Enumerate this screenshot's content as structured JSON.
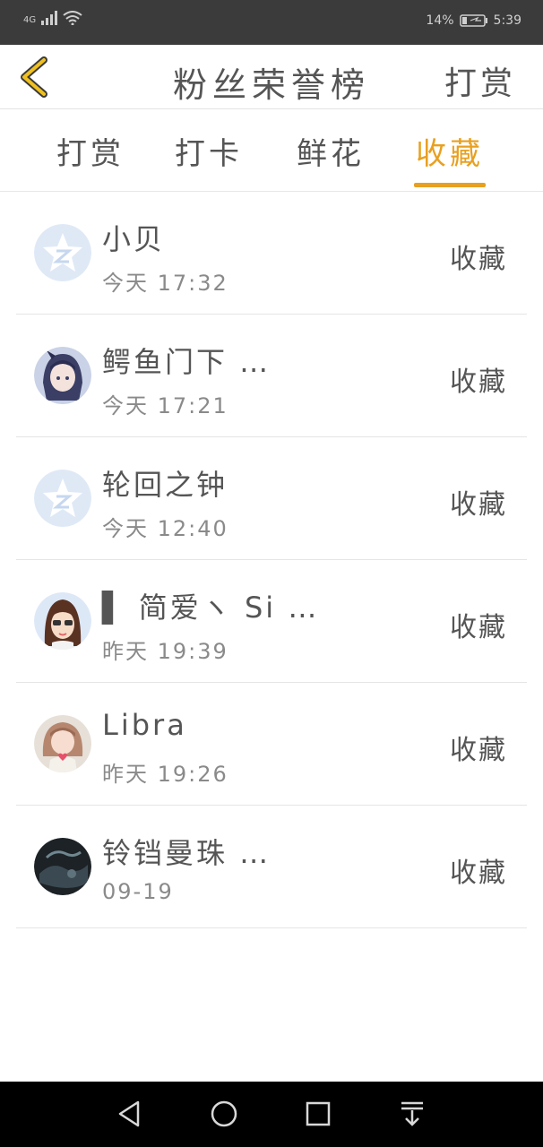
{
  "status_bar": {
    "network": "4G",
    "battery_percent": "14%",
    "time": "5:39"
  },
  "header": {
    "title": "粉丝荣誉榜",
    "action_label": "打赏"
  },
  "tabs": [
    {
      "label": "打赏",
      "active": false
    },
    {
      "label": "打卡",
      "active": false
    },
    {
      "label": "鲜花",
      "active": false
    },
    {
      "label": "收藏",
      "active": true
    }
  ],
  "list": [
    {
      "name": "小贝",
      "time": "今天 17:32",
      "action": "收藏",
      "avatar": "default-star-avatar"
    },
    {
      "name": "鳄鱼门下 …",
      "time": "今天 17:21",
      "action": "收藏",
      "avatar": "anime-girl-avatar"
    },
    {
      "name": "轮回之钟",
      "time": "今天 12:40",
      "action": "收藏",
      "avatar": "default-star-avatar"
    },
    {
      "name": "▌ 简爱ヽ Si …",
      "time": "昨天 19:39",
      "action": "收藏",
      "avatar": "girl-sunglasses-avatar"
    },
    {
      "name": "Libra",
      "time": "昨天 19:26",
      "action": "收藏",
      "avatar": "girl-heart-avatar"
    },
    {
      "name": "铃铛曼珠 …",
      "time": "09-19",
      "action": "收藏",
      "avatar": "dark-photo-avatar"
    }
  ],
  "colors": {
    "accent": "#e8a020",
    "status_bar": "#3b3b3b",
    "text": "#555555",
    "subtext": "#8a8a8a",
    "nav_bar": "#000000"
  }
}
